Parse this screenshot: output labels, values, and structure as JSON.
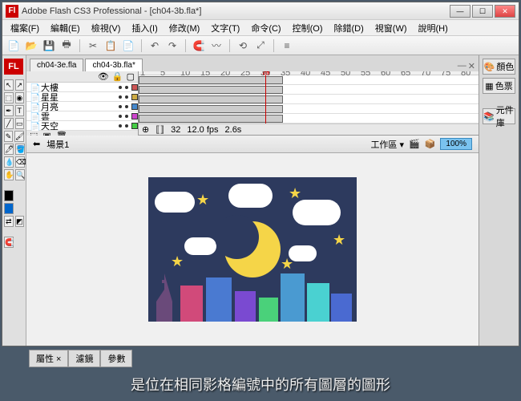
{
  "window": {
    "title": "Adobe Flash CS3 Professional - [ch04-3b.fla*]",
    "app_icon": "Fl"
  },
  "win_buttons": {
    "min": "—",
    "max": "☐",
    "close": "✕"
  },
  "menu": [
    "檔案(F)",
    "編輯(E)",
    "檢視(V)",
    "插入(I)",
    "修改(M)",
    "文字(T)",
    "命令(C)",
    "控制(O)",
    "除錯(D)",
    "視窗(W)",
    "說明(H)"
  ],
  "tabs": [
    {
      "label": "ch04-3e.fla"
    },
    {
      "label": "ch04-3b.fla*"
    }
  ],
  "ruler_marks": [
    "1",
    "5",
    "10",
    "15",
    "20",
    "25",
    "30",
    "35",
    "40",
    "45",
    "50",
    "55",
    "60",
    "65",
    "70",
    "75",
    "80"
  ],
  "layers": [
    {
      "name": "大樓",
      "color": "#cc5555"
    },
    {
      "name": "星星",
      "color": "#ccaa44"
    },
    {
      "name": "月亮",
      "color": "#4488cc"
    },
    {
      "name": "雲",
      "color": "#cc44cc"
    },
    {
      "name": "天空",
      "color": "#44cc44"
    }
  ],
  "layer_footer": [
    "⬚",
    "▣",
    "🗑"
  ],
  "frames_footer": {
    "frame": "32",
    "fps": "12.0 fps",
    "time": "2.6s"
  },
  "scene": {
    "icon": "⬅",
    "label": "場景1",
    "work": "工作區 ▾",
    "zoom": "100%"
  },
  "right_panels": [
    {
      "icon": "🎨",
      "label": "顏色"
    },
    {
      "icon": "▦",
      "label": "色票"
    },
    {
      "icon": "📚",
      "label": "元件庫"
    }
  ],
  "bottom_tabs": [
    "屬性 ×",
    "濾鏡",
    "參數"
  ],
  "subtitle": "是位在相同影格編號中的所有圖層的圖形",
  "flash_badge": "FL"
}
